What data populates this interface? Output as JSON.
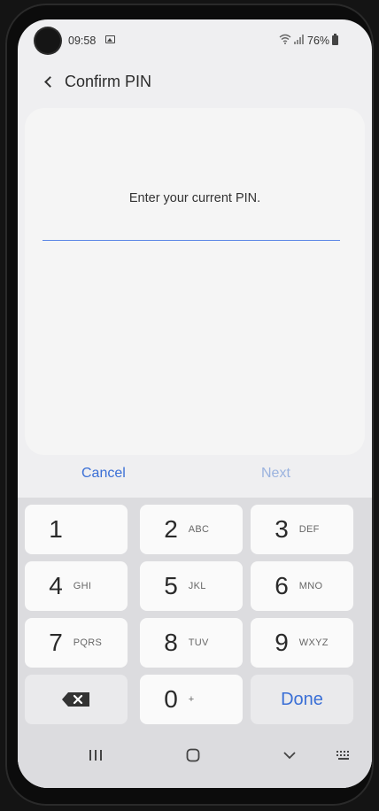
{
  "status": {
    "time": "09:58",
    "battery": "76%"
  },
  "header": {
    "title": "Confirm PIN"
  },
  "content": {
    "prompt": "Enter your current PIN.",
    "pin_value": ""
  },
  "actions": {
    "cancel_label": "Cancel",
    "next_label": "Next"
  },
  "keypad": {
    "keys": [
      {
        "digit": "1",
        "letters": ""
      },
      {
        "digit": "2",
        "letters": "ABC"
      },
      {
        "digit": "3",
        "letters": "DEF"
      },
      {
        "digit": "4",
        "letters": "GHI"
      },
      {
        "digit": "5",
        "letters": "JKL"
      },
      {
        "digit": "6",
        "letters": "MNO"
      },
      {
        "digit": "7",
        "letters": "PQRS"
      },
      {
        "digit": "8",
        "letters": "TUV"
      },
      {
        "digit": "9",
        "letters": "WXYZ"
      },
      {
        "digit": "0",
        "letters": "+"
      }
    ],
    "done_label": "Done"
  },
  "colors": {
    "accent": "#3a6fd6",
    "disabled_accent": "#9bb3df",
    "input_underline": "#5b86e5"
  }
}
